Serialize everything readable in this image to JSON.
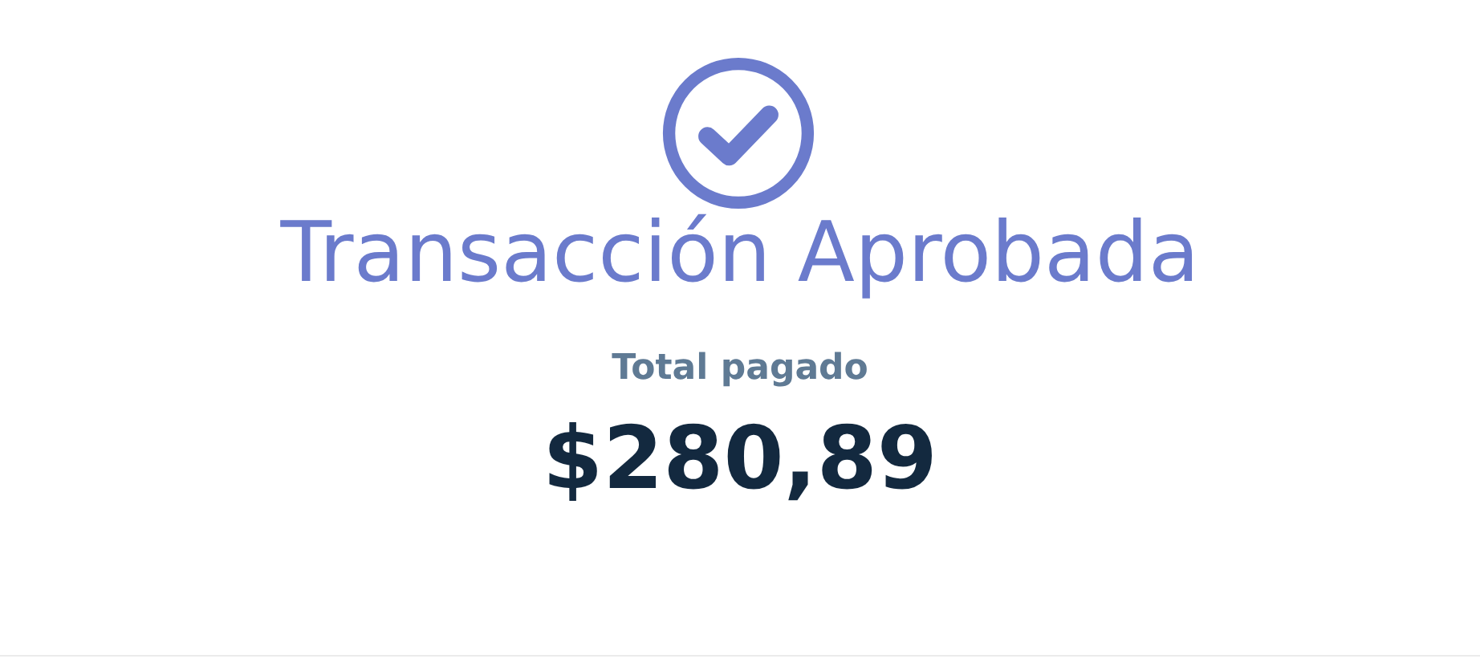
{
  "result": {
    "approved": true,
    "title": "Transacción Aprobada"
  },
  "total": {
    "label": "Total pagado",
    "amount": "$280,89"
  }
}
